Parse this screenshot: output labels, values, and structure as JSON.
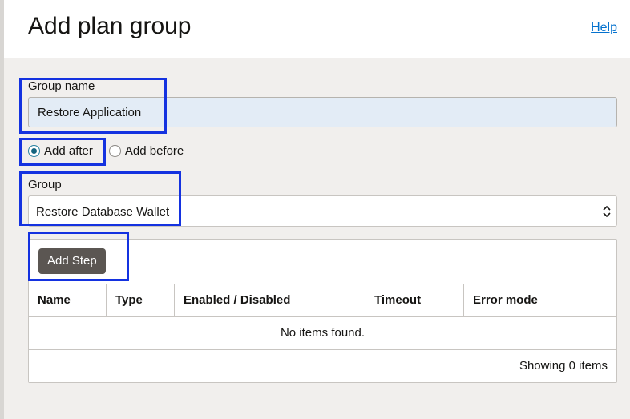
{
  "panel": {
    "title": "Add plan group",
    "help_link": "Help"
  },
  "group_name": {
    "label": "Group name",
    "value": "Restore Application"
  },
  "position": {
    "options": [
      {
        "label": "Add after",
        "checked": true
      },
      {
        "label": "Add before",
        "checked": false
      }
    ]
  },
  "group_select": {
    "label": "Group",
    "selected": "Restore Database Wallet"
  },
  "steps": {
    "add_button": "Add Step",
    "columns": [
      "Name",
      "Type",
      "Enabled / Disabled",
      "Timeout",
      "Error mode"
    ],
    "empty_message": "No items found.",
    "count_text": "Showing 0 items"
  },
  "colors": {
    "highlight": "#1432e0",
    "link": "#0572ce",
    "button": "#5b5652",
    "input_bg": "#e3ecf6"
  }
}
